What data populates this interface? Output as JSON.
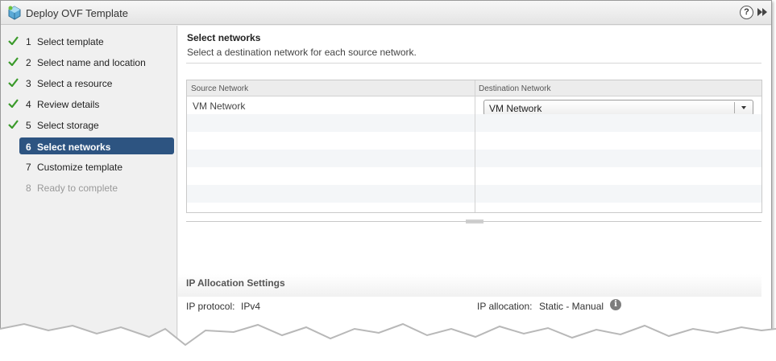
{
  "window": {
    "title": "Deploy OVF Template",
    "help_label": "?"
  },
  "steps": [
    {
      "num": "1",
      "label": "Select template",
      "state": "done"
    },
    {
      "num": "2",
      "label": "Select name and location",
      "state": "done"
    },
    {
      "num": "3",
      "label": "Select a resource",
      "state": "done"
    },
    {
      "num": "4",
      "label": "Review details",
      "state": "done"
    },
    {
      "num": "5",
      "label": "Select storage",
      "state": "done"
    },
    {
      "num": "6",
      "label": "Select networks",
      "state": "active"
    },
    {
      "num": "7",
      "label": "Customize template",
      "state": "pending"
    },
    {
      "num": "8",
      "label": "Ready to complete",
      "state": "disabled"
    }
  ],
  "content": {
    "title": "Select networks",
    "description": "Select a destination network for each source network."
  },
  "grid": {
    "columns": [
      "Source Network",
      "Destination Network"
    ],
    "rows": [
      {
        "source": "VM Network",
        "destination": "VM Network"
      }
    ]
  },
  "ip_settings": {
    "title": "IP Allocation Settings",
    "protocol_label": "IP protocol:",
    "protocol_value": "IPv4",
    "allocation_label": "IP allocation:",
    "allocation_value": "Static - Manual",
    "info_glyph": "i"
  },
  "colors": {
    "active_step_bg": "#2d5481",
    "check_green": "#3a9a2a"
  }
}
